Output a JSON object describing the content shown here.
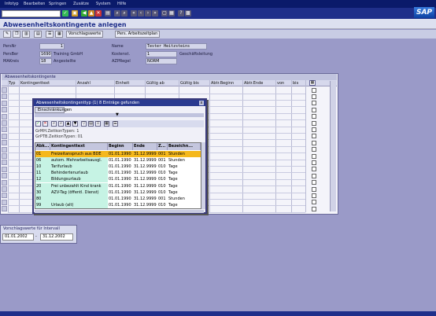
{
  "menu": {
    "items": [
      "Infotyp",
      "Bearbeiten",
      "Springen",
      "Zusätze",
      "System",
      "Hilfe"
    ]
  },
  "toolbar": {
    "command_placeholder": ""
  },
  "logo": "SAP",
  "window": {
    "title": "Abwesenheitskontingente anlegen"
  },
  "app_toolbar": {
    "vorschlagswerte": "Vorschlagswerte",
    "pers_arbeitszeitplan": "Pers. Arbeitszeitplan"
  },
  "header": {
    "persnr_label": "PersNr",
    "persnr_value": "1",
    "persber_label": "PersBer",
    "persber_code": "1690",
    "persber_text": "Training GmbH",
    "mitarb_label": "MAKreis",
    "mitarb_code": "18",
    "mitarb_text": "Angestellte",
    "name_label": "Name",
    "name_value": "Tester Heitzsteins",
    "kostenst_label": "Kostenst.",
    "kostenst_value": "1",
    "kostenst_text": "Geschäftsleitung",
    "azpregel_label": "AZPRegel",
    "azpregel_value": "NORM"
  },
  "table": {
    "caption": "Abwesenheitskontingente",
    "columns": [
      "Typ",
      "Kontingenttext",
      "Anzahl",
      "Einheit",
      "Gültig ab",
      "Gültig bis",
      "Abtr.Beginn",
      "Abtr.Ende",
      "von",
      "bis"
    ]
  },
  "popup": {
    "title": "Abwesenheitskontingenttyp (1)  8 Einträge gefunden",
    "close": "x",
    "tab": "Einschränkungen",
    "info1": "GrMH.ZeitkonTypen: 1",
    "info2": "GrPTB.ZeitkonTypen: 01",
    "columns": [
      "Abk...",
      "Kontingenttext",
      "Beginn",
      "Ende",
      "Z...",
      "Bezeichn..."
    ],
    "rows": [
      {
        "abk": "01",
        "text": "Freizeitanspruch aus BDE",
        "beginn": "01.01.1990",
        "ende": "31.12.9999",
        "z": "001",
        "bez": "Stunden"
      },
      {
        "abk": "06",
        "text": "autom. Mehrarbeitsausgl.",
        "beginn": "01.01.1990",
        "ende": "31.12.9999",
        "z": "001",
        "bez": "Stunden"
      },
      {
        "abk": "10",
        "text": "Tarifurlaub",
        "beginn": "01.01.1990",
        "ende": "31.12.9999",
        "z": "010",
        "bez": "Tage"
      },
      {
        "abk": "11",
        "text": "Behindertenurlaub",
        "beginn": "01.01.1990",
        "ende": "31.12.9999",
        "z": "010",
        "bez": "Tage"
      },
      {
        "abk": "12",
        "text": "Bildungsurlaub",
        "beginn": "01.01.1990",
        "ende": "31.12.9999",
        "z": "010",
        "bez": "Tage"
      },
      {
        "abk": "20",
        "text": "Frei unbezahlt Kind krank",
        "beginn": "01.01.1990",
        "ende": "31.12.9999",
        "z": "010",
        "bez": "Tage"
      },
      {
        "abk": "30",
        "text": "AZV-Tag (öffentl. Dienst)",
        "beginn": "01.01.1990",
        "ende": "31.12.9999",
        "z": "010",
        "bez": "Tage"
      },
      {
        "abk": "80",
        "text": "",
        "beginn": "01.01.1990",
        "ende": "31.12.9999",
        "z": "001",
        "bez": "Stunden"
      },
      {
        "abk": "99",
        "text": "Urlaub (alt)",
        "beginn": "01.01.1990",
        "ende": "31.12.9999",
        "z": "010",
        "bez": "Tage"
      }
    ]
  },
  "interval": {
    "caption": "Vorschlagswerte für Intervall",
    "from": "01.01.2002",
    "sep": "-",
    "to": "31.12.2002"
  },
  "colors": {
    "highlight_row": "#f5b81c",
    "title_blue": "#1f2f8a",
    "row_green": "#c6f3e4"
  }
}
